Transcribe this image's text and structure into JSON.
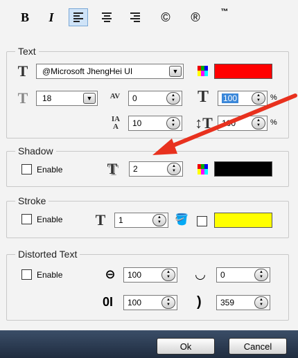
{
  "toolbar": {
    "bold": "B",
    "italic": "I",
    "copyright": "©",
    "registered": "®",
    "trademark": "™"
  },
  "text_group": {
    "legend": "Text",
    "font": "@Microsoft JhengHei UI",
    "size": "18",
    "spacing": "0",
    "scale_w": "100",
    "line_height": "10",
    "scale_h": "100",
    "percent_1": "%",
    "percent_2": "%",
    "color": "#ff0000"
  },
  "shadow_group": {
    "legend": "Shadow",
    "enable_label": "Enable",
    "value": "2",
    "color": "#000000"
  },
  "stroke_group": {
    "legend": "Stroke",
    "enable_label": "Enable",
    "value": "1",
    "color": "#ffff00"
  },
  "distorted_group": {
    "legend": "Distorted Text",
    "enable_label": "Enable",
    "width": "100",
    "height": "100",
    "angle_start": "0",
    "angle_end": "359"
  },
  "footer": {
    "ok": "Ok",
    "cancel": "Cancel"
  }
}
